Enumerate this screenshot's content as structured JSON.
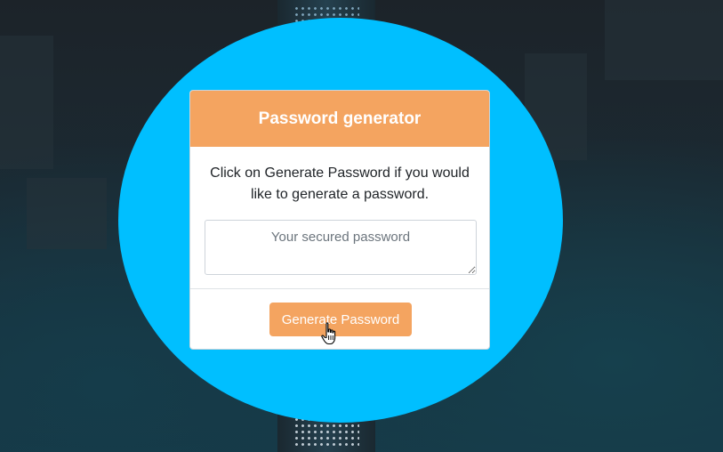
{
  "card": {
    "title": "Password generator",
    "description": "Click on Generate Password if you would like to generate a password.",
    "password_placeholder": "Your secured password",
    "password_value": "",
    "generate_label": "Generate Password"
  },
  "colors": {
    "circle": "#00bfff",
    "accent": "#f4a460",
    "background": "#1c2329"
  },
  "icons": {
    "cursor": "hand-pointer-icon",
    "resize": "resize-handle-icon"
  }
}
